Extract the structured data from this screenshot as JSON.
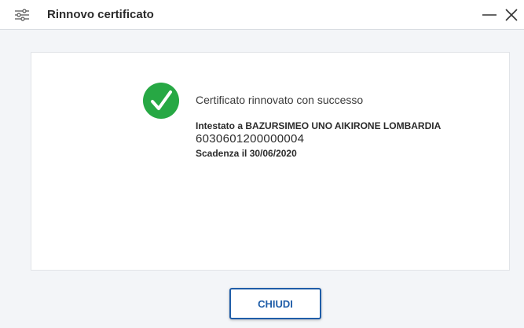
{
  "window": {
    "title": "Rinnovo certificato",
    "settings_icon": "sliders-icon",
    "minimize_icon": "minimize-icon",
    "close_icon": "close-icon"
  },
  "result": {
    "status_icon": "check-icon",
    "message": "Certificato rinnovato con successo",
    "owner_prefix": "Intestato a ",
    "owner_name": "BAZURSIMEO UNO AIKIRONE LOMBARDIA",
    "serial_number": "6030601200000004",
    "expiry_prefix": "Scadenza il ",
    "expiry_date": "30/06/2020"
  },
  "actions": {
    "close_label": "CHIUDI"
  },
  "colors": {
    "accent": "#1f5da8",
    "success": "#27a844",
    "background": "#f3f5f8"
  }
}
